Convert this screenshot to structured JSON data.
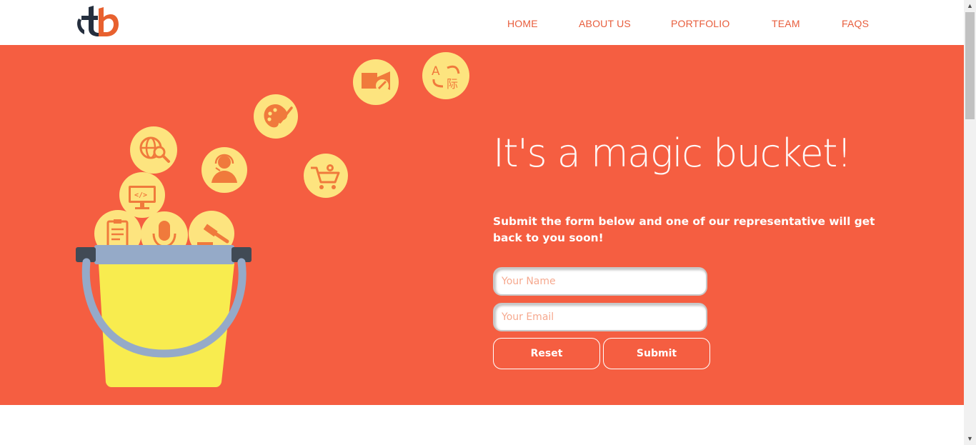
{
  "header": {
    "logo_icon": "tb-logo-icon",
    "nav": [
      "HOME",
      "ABOUT US",
      "PORTFOLIO",
      "TEAM",
      "FAQS"
    ]
  },
  "hero": {
    "headline": "It's a magic bucket!",
    "subtext": "Submit the form below and one of our representative will get back to you soon!",
    "form": {
      "name_placeholder": "Your Name",
      "email_placeholder": "Your Email",
      "reset_label": "Reset",
      "submit_label": "Submit"
    },
    "icons": [
      "video-edit-icon",
      "translate-icon",
      "palette-icon",
      "globe-search-icon",
      "support-agent-icon",
      "shopping-cart-icon",
      "code-monitor-icon",
      "document-icon",
      "microphone-icon",
      "gavel-icon"
    ]
  },
  "colors": {
    "accent": "#f55e41",
    "nav_text": "#e85d3c",
    "bubble": "#fde47f",
    "bucket": "#f8ec4f",
    "bucket_rim": "#95aac8"
  }
}
